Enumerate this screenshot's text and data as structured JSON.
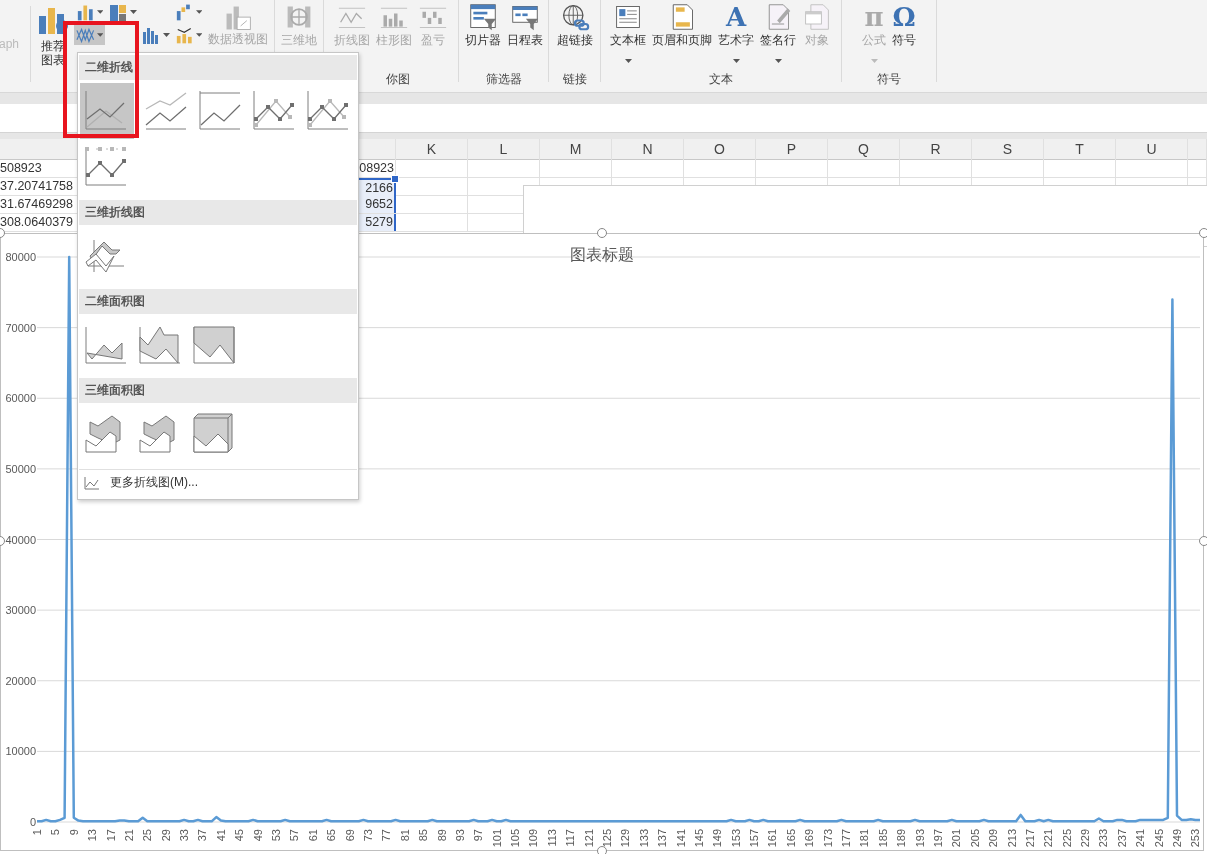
{
  "ribbon": {
    "cut_label": "aph",
    "charts": {
      "recommended": [
        "推荐",
        "图表"
      ],
      "small_buttons": [
        {
          "kind": "column",
          "selected": false
        },
        {
          "kind": "hierarchy",
          "selected": false
        },
        {
          "kind": "waterfall",
          "selected": false
        },
        {
          "kind": "line",
          "selected": true
        },
        {
          "kind": "bar",
          "selected": false
        },
        {
          "kind": "scatter",
          "selected": false
        }
      ],
      "pivot": {
        "label": "数据透视图",
        "disabled": true
      }
    },
    "groups": [
      {
        "buttons": [
          {
            "kind": "map",
            "label": "三维地",
            "disabled": true,
            "caret": false
          }
        ]
      },
      {
        "label": "你图",
        "buttons": [
          {
            "kind": "spark-line",
            "label": "折线图",
            "disabled": true,
            "caret": false
          },
          {
            "kind": "spark-column",
            "label": "柱形图",
            "disabled": true,
            "caret": false
          },
          {
            "kind": "win-loss",
            "label": "盈亏",
            "disabled": true,
            "caret": false
          }
        ]
      },
      {
        "label": "筛选器",
        "buttons": [
          {
            "kind": "slicer",
            "label": "切片器",
            "disabled": false,
            "caret": false
          },
          {
            "kind": "timeline",
            "label": "日程表",
            "disabled": false,
            "caret": false
          }
        ]
      },
      {
        "label": "链接",
        "buttons": [
          {
            "kind": "hyperlink",
            "label": "超链接",
            "disabled": false,
            "caret": false
          }
        ]
      },
      {
        "label": "文本",
        "buttons": [
          {
            "kind": "textbox",
            "label": "文本框",
            "disabled": false,
            "caret": true
          },
          {
            "kind": "header-footer",
            "label": "页眉和页脚",
            "disabled": false,
            "caret": false
          },
          {
            "kind": "wordart",
            "glyph": "A",
            "label": "艺术字",
            "disabled": false,
            "caret": true
          },
          {
            "kind": "signature",
            "label": "签名行",
            "disabled": false,
            "caret": true
          },
          {
            "kind": "object",
            "label": "对象",
            "disabled": true,
            "caret": false
          }
        ]
      },
      {
        "label": "符号",
        "buttons": [
          {
            "kind": "equation",
            "glyph": "π",
            "label": "公式",
            "disabled": true,
            "caret": true
          },
          {
            "kind": "symbol",
            "glyph": "Ω",
            "label": "符号",
            "disabled": false,
            "caret": false
          }
        ]
      }
    ]
  },
  "sheet": {
    "columns": [
      "K",
      "L",
      "M",
      "N",
      "O",
      "P",
      "Q",
      "R",
      "S",
      "T",
      "U"
    ],
    "rows": [
      {
        "column_a": "508923",
        "column_j": "08923",
        "selected": false
      },
      {
        "column_a": "37.20741758",
        "column_j": "2166",
        "selected": true
      },
      {
        "column_a": "31.67469298",
        "column_j": "9652",
        "selected": true
      },
      {
        "column_a": "308.0640379",
        "column_j": "5279",
        "selected": true
      }
    ]
  },
  "chart": {
    "title": "图表标题",
    "chart_data": {
      "type": "line",
      "ylim": [
        0,
        80000
      ],
      "yticks": [
        0,
        10000,
        20000,
        30000,
        40000,
        50000,
        60000,
        70000,
        80000
      ],
      "xlim": [
        1,
        254
      ],
      "grid": true,
      "xticks": [
        1,
        5,
        9,
        13,
        17,
        21,
        25,
        29,
        33,
        37,
        41,
        45,
        49,
        53,
        57,
        61,
        65,
        69,
        73,
        77,
        81,
        85,
        89,
        93,
        97,
        101,
        105,
        109,
        113,
        117,
        121,
        125,
        129,
        133,
        137,
        141,
        145,
        149,
        153,
        157,
        161,
        165,
        169,
        173,
        177,
        181,
        185,
        189,
        193,
        197,
        201,
        205,
        209,
        213,
        217,
        221,
        225,
        229,
        233,
        237,
        241,
        245,
        249,
        253
      ],
      "x": [
        1,
        2,
        3,
        4,
        5,
        6,
        7,
        8,
        9,
        10,
        11,
        12,
        13,
        14,
        15,
        16,
        17,
        18,
        19,
        20,
        21,
        22,
        23,
        24,
        25,
        26,
        27,
        28,
        29,
        30,
        31,
        32,
        33,
        34,
        35,
        36,
        37,
        38,
        39,
        40,
        41,
        42,
        43,
        44,
        45,
        46,
        47,
        48,
        49,
        50,
        51,
        52,
        53,
        54,
        55,
        56,
        57,
        58,
        59,
        60,
        61,
        62,
        63,
        64,
        65,
        66,
        67,
        68,
        69,
        70,
        71,
        72,
        73,
        74,
        75,
        76,
        77,
        78,
        79,
        80,
        81,
        82,
        83,
        84,
        85,
        86,
        87,
        88,
        89,
        90,
        91,
        92,
        93,
        94,
        95,
        96,
        97,
        98,
        99,
        100,
        101,
        102,
        103,
        104,
        105,
        106,
        107,
        108,
        109,
        110,
        111,
        112,
        113,
        114,
        115,
        116,
        117,
        118,
        119,
        120,
        121,
        122,
        123,
        124,
        125,
        126,
        127,
        128,
        129,
        130,
        131,
        132,
        133,
        134,
        135,
        136,
        137,
        138,
        139,
        140,
        141,
        142,
        143,
        144,
        145,
        146,
        147,
        148,
        149,
        150,
        151,
        152,
        153,
        154,
        155,
        156,
        157,
        158,
        159,
        160,
        161,
        162,
        163,
        164,
        165,
        166,
        167,
        168,
        169,
        170,
        171,
        172,
        173,
        174,
        175,
        176,
        177,
        178,
        179,
        180,
        181,
        182,
        183,
        184,
        185,
        186,
        187,
        188,
        189,
        190,
        191,
        192,
        193,
        194,
        195,
        196,
        197,
        198,
        199,
        200,
        201,
        202,
        203,
        204,
        205,
        206,
        207,
        208,
        209,
        210,
        211,
        212,
        213,
        214,
        215,
        216,
        217,
        218,
        219,
        220,
        221,
        222,
        223,
        224,
        225,
        226,
        227,
        228,
        229,
        230,
        231,
        232,
        233,
        234,
        235,
        236,
        237,
        238,
        239,
        240,
        241,
        242,
        243,
        244,
        245,
        246,
        247,
        248,
        249,
        250,
        251,
        252,
        253,
        254
      ],
      "series": [
        {
          "color": "#5b9bd5",
          "values": [
            100,
            100,
            300,
            100,
            100,
            300,
            600,
            80000,
            600,
            200,
            100,
            100,
            100,
            100,
            100,
            100,
            100,
            100,
            200,
            200,
            100,
            100,
            100,
            600,
            100,
            100,
            100,
            100,
            100,
            100,
            100,
            100,
            300,
            100,
            100,
            300,
            100,
            100,
            100,
            700,
            200,
            100,
            100,
            100,
            100,
            100,
            100,
            300,
            100,
            100,
            100,
            100,
            100,
            100,
            300,
            100,
            100,
            100,
            100,
            100,
            100,
            100,
            100,
            300,
            100,
            100,
            100,
            100,
            100,
            100,
            100,
            300,
            100,
            100,
            100,
            100,
            100,
            100,
            300,
            100,
            100,
            100,
            100,
            100,
            100,
            100,
            300,
            100,
            100,
            100,
            100,
            100,
            100,
            100,
            100,
            300,
            100,
            100,
            100,
            300,
            100,
            100,
            300,
            100,
            100,
            100,
            100,
            100,
            100,
            100,
            100,
            100,
            100,
            100,
            100,
            100,
            100,
            100,
            100,
            100,
            100,
            100,
            100,
            100,
            100,
            100,
            100,
            100,
            100,
            100,
            100,
            100,
            100,
            100,
            100,
            100,
            100,
            100,
            100,
            100,
            100,
            100,
            100,
            100,
            100,
            100,
            100,
            100,
            100,
            100,
            100,
            300,
            100,
            100,
            100,
            300,
            100,
            100,
            300,
            100,
            100,
            100,
            100,
            100,
            100,
            100,
            300,
            100,
            100,
            100,
            100,
            100,
            100,
            100,
            100,
            300,
            100,
            100,
            100,
            100,
            100,
            100,
            100,
            300,
            100,
            100,
            100,
            100,
            100,
            100,
            100,
            300,
            100,
            100,
            100,
            100,
            100,
            100,
            100,
            300,
            100,
            100,
            100,
            100,
            100,
            100,
            300,
            100,
            100,
            100,
            100,
            100,
            100,
            100,
            1000,
            100,
            100,
            100,
            300,
            100,
            300,
            100,
            100,
            100,
            100,
            100,
            100,
            100,
            100,
            100,
            100,
            500,
            100,
            100,
            100,
            300,
            300,
            100,
            100,
            100,
            300,
            300,
            300,
            300,
            300,
            300,
            600,
            74000,
            900,
            300,
            300,
            400,
            300,
            300
          ]
        }
      ]
    }
  },
  "line_menu": {
    "sections": [
      {
        "title": "二维折线",
        "items": [
          {
            "kind": "line",
            "selected": true
          },
          {
            "kind": "stacked-line",
            "selected": false
          },
          {
            "kind": "full-line",
            "selected": false
          },
          {
            "kind": "line-markers",
            "selected": false
          },
          {
            "kind": "stacked-markers",
            "selected": false
          },
          {
            "kind": "full-markers",
            "selected": false
          }
        ]
      },
      {
        "title": "三维折线图",
        "items": [
          {
            "kind": "line-3d",
            "selected": false
          }
        ]
      },
      {
        "title": "二维面积图",
        "items": [
          {
            "kind": "area",
            "selected": false
          },
          {
            "kind": "stacked-area",
            "selected": false
          },
          {
            "kind": "full-area",
            "selected": false
          }
        ]
      },
      {
        "title": "三维面积图",
        "items": [
          {
            "kind": "area-3d",
            "selected": false
          },
          {
            "kind": "stacked-area-3d",
            "selected": false
          },
          {
            "kind": "full-area-3d",
            "selected": false
          }
        ]
      }
    ],
    "more": "更多折线图(M)..."
  }
}
